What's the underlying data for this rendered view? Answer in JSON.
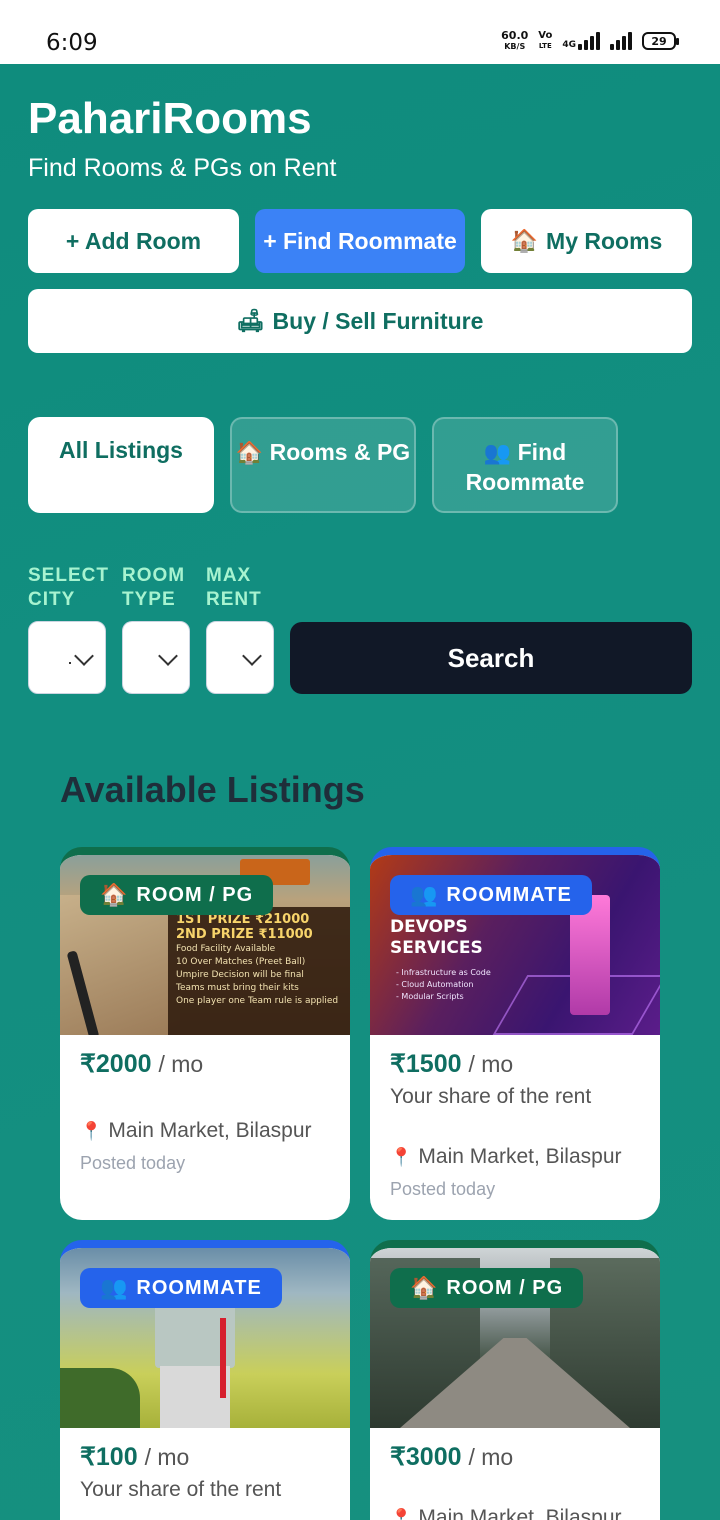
{
  "status_bar": {
    "time": "6:09",
    "net_speed_value": "60.0",
    "net_speed_unit": "KB/S",
    "volte_top": "Vo",
    "volte_bottom": "LTE",
    "network_type": "4G",
    "battery": "29"
  },
  "header": {
    "brand": "PahariRooms",
    "tagline": "Find Rooms & PGs on Rent"
  },
  "actions": {
    "add_room": "+ Add Room",
    "find_roommate": "+ Find Roommate",
    "my_rooms": "My Rooms",
    "buy_sell": "Buy / Sell Furniture"
  },
  "tabs": [
    {
      "label": "All Listings",
      "active": true
    },
    {
      "icon": "🏠",
      "label": "Rooms & PG"
    },
    {
      "icon": "👥",
      "label": "Find Roommate"
    }
  ],
  "filters": {
    "city_label": "SELECT CITY",
    "room_type_label": "ROOM TYPE",
    "max_rent_label": "MAX RENT",
    "search_label": "Search"
  },
  "listings_title": "Available Listings",
  "listings": [
    {
      "badge": "ROOM / PG",
      "badge_icon": "🏠",
      "price": "₹2000",
      "per": "/ mo",
      "share": "",
      "location": "Main Market, Bilaspur",
      "posted": "Posted today",
      "image_text": {
        "line1": "1ST PRIZE ₹21000",
        "line2": "2ND PRIZE ₹11000",
        "bullets": [
          "Food Facility Available",
          "10 Over Matches (Preet Ball)",
          "Umpire Decision will be final",
          "Teams must bring their kits",
          "One player one Team rule is applied"
        ]
      }
    },
    {
      "badge": "ROOMMATE",
      "badge_icon": "👥",
      "price": "₹1500",
      "per": "/ mo",
      "share": "Your share of the rent",
      "location": "Main Market, Bilaspur",
      "posted": "Posted today",
      "image_text": {
        "title1": "DEVOPS",
        "title2": "SERVICES",
        "bullets": [
          "- Infrastructure as Code",
          "- Cloud Automation",
          "- Modular Scripts"
        ]
      }
    },
    {
      "badge": "ROOMMATE",
      "badge_icon": "👥",
      "price": "₹100",
      "per": "/ mo",
      "share": "Your share of the rent"
    },
    {
      "badge": "ROOM / PG",
      "badge_icon": "🏠",
      "price": "₹3000",
      "per": "/ mo",
      "location": "Main Market, Bilaspur"
    }
  ],
  "colors": {
    "brand_teal": "#0f8c7d",
    "accent_blue": "#3b82f6",
    "badge_green": "#0f6e4c",
    "badge_blue": "#2563eb",
    "search_button": "#111827"
  }
}
